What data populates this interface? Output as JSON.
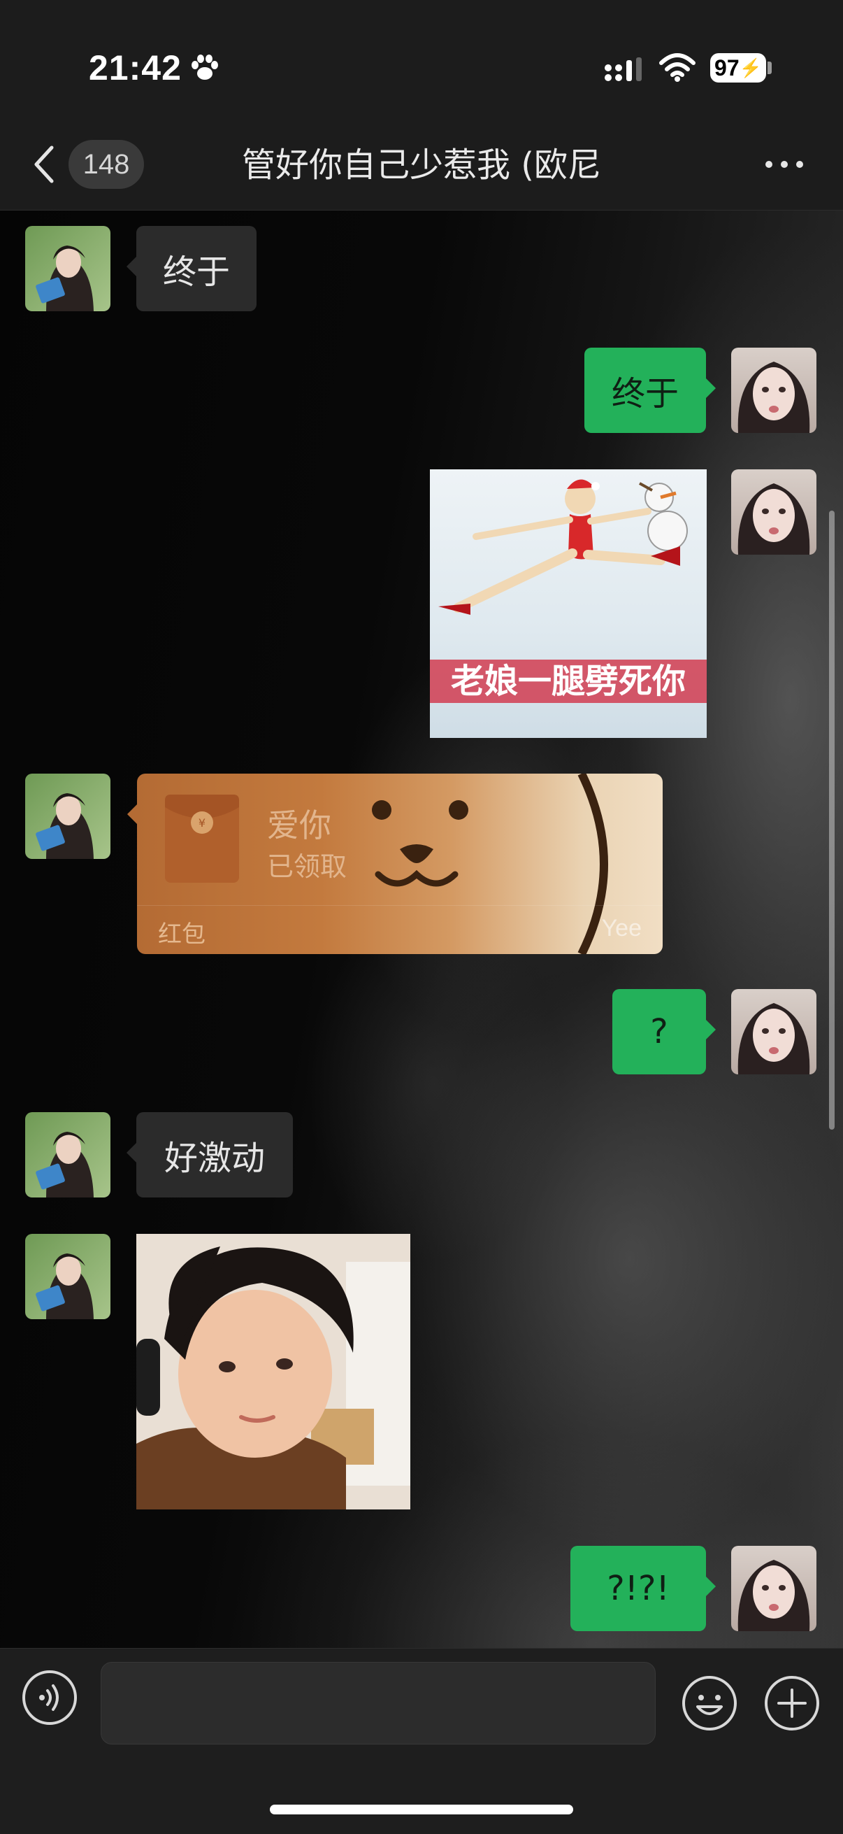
{
  "status_bar": {
    "time": "21:42",
    "battery": "97"
  },
  "nav": {
    "unread_count": "148",
    "title": "管好你自己少惹我 (欧尼"
  },
  "messages": [
    {
      "direction": "in",
      "type": "text",
      "text": "终于"
    },
    {
      "direction": "out",
      "type": "text",
      "text": "终于"
    },
    {
      "direction": "out",
      "type": "sticker",
      "caption": "老娘一腿劈死你"
    },
    {
      "direction": "in",
      "type": "red_packet",
      "title": "爱你",
      "status": "已领取",
      "label": "红包",
      "brand": "Yee"
    },
    {
      "direction": "out",
      "type": "text",
      "text": "?"
    },
    {
      "direction": "in",
      "type": "text",
      "text": "好激动"
    },
    {
      "direction": "in",
      "type": "image",
      "image": "photo-of-child-face"
    },
    {
      "direction": "out",
      "type": "text",
      "text": "?!?!"
    }
  ],
  "input": {
    "value": "",
    "placeholder": ""
  },
  "colors": {
    "outgoing_bubble": "#23b15a",
    "incoming_bubble": "#2b2b2b",
    "bar_background": "#1c1c1c"
  },
  "icons": {
    "status": [
      "paw-icon",
      "signal-icon",
      "wifi-icon",
      "battery-icon"
    ],
    "nav": [
      "back-icon",
      "more-icon"
    ],
    "input_bar": [
      "voice-icon",
      "emoji-icon",
      "plus-icon"
    ]
  }
}
